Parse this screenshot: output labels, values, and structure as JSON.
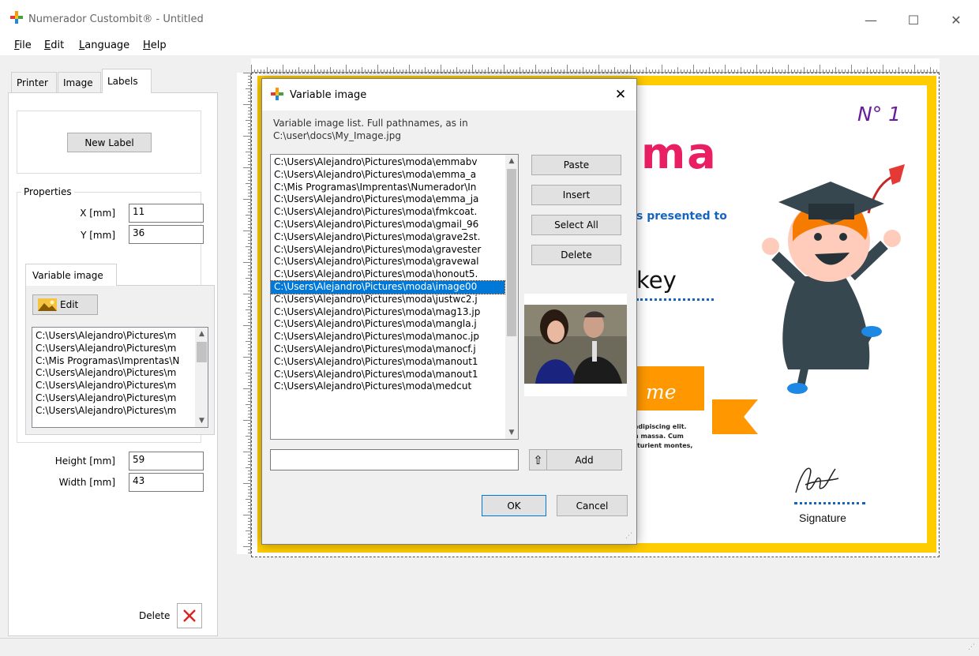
{
  "app": {
    "title": "Numerador Custombit® - Untitled",
    "window_controls": [
      "—",
      "☐",
      "✕"
    ]
  },
  "menu": [
    {
      "label": "File",
      "accel": "F",
      "rest": "ile"
    },
    {
      "label": "Edit",
      "accel": "E",
      "rest": "dit"
    },
    {
      "label": "Language",
      "accel": "L",
      "rest": "anguage"
    },
    {
      "label": "Help",
      "accel": "H",
      "rest": "elp"
    }
  ],
  "left_tabs": [
    "Printer",
    "Image",
    "Labels"
  ],
  "labels_panel": {
    "new_label_button": "New Label",
    "properties_title": "Properties",
    "x_label": "X [mm]",
    "x_value": "11",
    "y_label": "Y [mm]",
    "y_value": "36",
    "variable_image_tab": "Variable image",
    "edit_button": "Edit",
    "image_list": [
      "C:\\Users\\Alejandro\\Pictures\\m",
      "C:\\Users\\Alejandro\\Pictures\\m",
      "C:\\Mis Programas\\Imprentas\\N",
      "C:\\Users\\Alejandro\\Pictures\\m",
      "C:\\Users\\Alejandro\\Pictures\\m",
      "C:\\Users\\Alejandro\\Pictures\\m",
      "C:\\Users\\Alejandro\\Pictures\\m"
    ],
    "height_label": "Height [mm]",
    "height_value": "59",
    "width_label": "Width [mm]",
    "width_value": "43",
    "delete_label": "Delete"
  },
  "certificate": {
    "number": "N° 1",
    "title_fragment": "ma",
    "presented": "s presented to",
    "name_fragment": "key",
    "ribbon_text": "me",
    "lorem": [
      "adipiscing elit.",
      "n massa. Cum",
      "rturient montes,"
    ],
    "signature_label": "Signature",
    "colors": {
      "frame": "#ffcc00",
      "title": "#29b6f6",
      "accent": "#ff9800",
      "number": "#6a1b9a"
    }
  },
  "dialog": {
    "title": "Variable image",
    "description_line1": "Variable image list. Full pathnames, as in",
    "description_line2": "C:\\user\\docs\\My_Image.jpg",
    "list": [
      "C:\\Users\\Alejandro\\Pictures\\moda\\emmabv",
      "C:\\Users\\Alejandro\\Pictures\\moda\\emma_a",
      "C:\\Mis Programas\\Imprentas\\Numerador\\In",
      "C:\\Users\\Alejandro\\Pictures\\moda\\emma_ja",
      "C:\\Users\\Alejandro\\Pictures\\moda\\fmkcoat.",
      "C:\\Users\\Alejandro\\Pictures\\moda\\gmail_96",
      "C:\\Users\\Alejandro\\Pictures\\moda\\grave2st.",
      "C:\\Users\\Alejandro\\Pictures\\moda\\gravester",
      "C:\\Users\\Alejandro\\Pictures\\moda\\gravewal",
      "C:\\Users\\Alejandro\\Pictures\\moda\\honout5.",
      "C:\\Users\\Alejandro\\Pictures\\moda\\image00",
      "C:\\Users\\Alejandro\\Pictures\\moda\\justwc2.j",
      "C:\\Users\\Alejandro\\Pictures\\moda\\mag13.jp",
      "C:\\Users\\Alejandro\\Pictures\\moda\\mangla.j",
      "C:\\Users\\Alejandro\\Pictures\\moda\\manoc.jp",
      "C:\\Users\\Alejandro\\Pictures\\moda\\manocf.j",
      "C:\\Users\\Alejandro\\Pictures\\moda\\manout1",
      "C:\\Users\\Alejandro\\Pictures\\moda\\manout1",
      "C:\\Users\\Alejandro\\Pictures\\moda\\medcut"
    ],
    "selected_index": 10,
    "buttons": {
      "paste": "Paste",
      "insert": "Insert",
      "select_all": "Select All",
      "delete": "Delete",
      "add": "Add",
      "ok": "OK",
      "cancel": "Cancel"
    },
    "path_input": ""
  }
}
